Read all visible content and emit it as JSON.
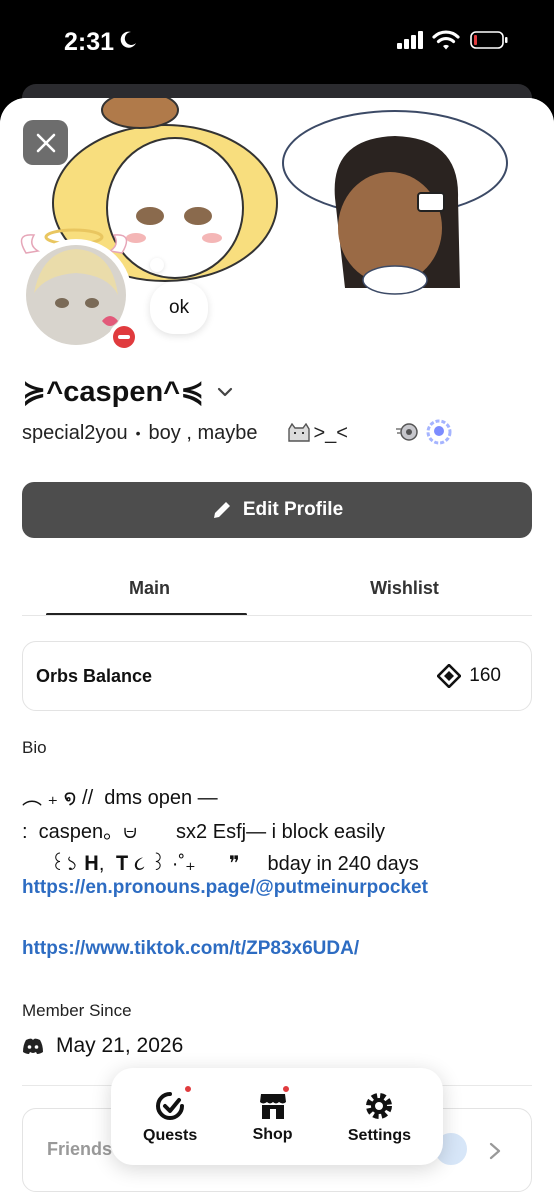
{
  "status_bar": {
    "time": "2:31"
  },
  "profile": {
    "display_name": "≽^caspen^≼",
    "username": "special2you",
    "separator": "•",
    "pronouns": "boy , maybe",
    "kitty_text": ">_<",
    "custom_status": "ok"
  },
  "actions": {
    "edit_profile": "Edit Profile"
  },
  "tabs": [
    {
      "label": "Main"
    },
    {
      "label": "Wishlist"
    }
  ],
  "orbs": {
    "label": "Orbs Balance",
    "value": "160"
  },
  "bio": {
    "label": "Bio",
    "lines": [
      "︵ ₊ ໑ //  dms open —",
      ":  caspen。⩁       sx2 Esfj— i block easily",
      "     ꒰১ 𝐇,  𝐓 ૮ ꒱ ·˚₊      ❞     bday in 240 days"
    ],
    "links": [
      "https://en.pronouns.page/@putmeinurpocket",
      "https://www.tiktok.com/t/ZP83x6UDA/"
    ]
  },
  "member_since": {
    "label": "Member Since",
    "date": "May 21, 2026"
  },
  "friends": {
    "label": "Friends"
  },
  "bottom_nav": [
    {
      "label": "Quests"
    },
    {
      "label": "Shop"
    },
    {
      "label": "Settings"
    }
  ],
  "colors": {
    "link": "#2d6cc2",
    "dnd": "#e03b3e",
    "button_dark": "#4d4d4d"
  }
}
